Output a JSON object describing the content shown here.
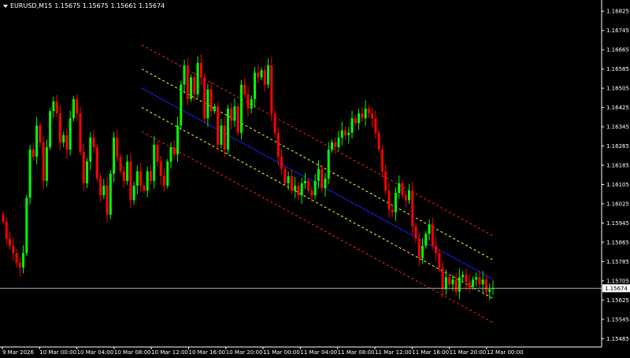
{
  "header": {
    "menu_icon": "triangle-down-icon",
    "symbol": "EURUSD,M15",
    "ohlc": "1.15675 1.15675 1.15661 1.15674"
  },
  "colors": {
    "background": "#000000",
    "bull": "#00ff00",
    "bear": "#ff0000",
    "channel_outer": "#ff2020",
    "channel_inner": "#ffff33",
    "regression": "#1e1eff",
    "bid_line": "#a0a0a0",
    "axis": "#ffffff"
  },
  "chart_data": {
    "type": "candlestick",
    "symbol": "EURUSD",
    "timeframe": "M15",
    "current_price": 1.15674,
    "y_range": [
      1.1543,
      1.1686
    ],
    "y_ticks": [
      "1.16825",
      "1.16745",
      "1.16665",
      "1.16585",
      "1.16505",
      "1.16425",
      "1.16345",
      "1.16265",
      "1.16185",
      "1.16105",
      "1.16025",
      "1.15945",
      "1.15865",
      "1.15785",
      "1.15705",
      "1.15625",
      "1.15545",
      "1.15465"
    ],
    "x_ticks": [
      "9 Mar 2026",
      "10 Mar 00:00",
      "10 Mar 04:00",
      "10 Mar 08:00",
      "10 Mar 12:00",
      "10 Mar 16:00",
      "10 Mar 20:00",
      "11 Mar 00:00",
      "11 Mar 04:00",
      "11 Mar 08:00",
      "11 Mar 12:00",
      "11 Mar 16:00",
      "11 Mar 20:00",
      "12 Mar 00:00"
    ],
    "candle_closes": [
      1.1595,
      1.1588,
      1.1585,
      1.1582,
      1.1578,
      1.1576,
      1.1582,
      1.1605,
      1.1625,
      1.1622,
      1.1635,
      1.1628,
      1.1612,
      1.1626,
      1.1641,
      1.1645,
      1.164,
      1.1628,
      1.1631,
      1.1625,
      1.1638,
      1.1646,
      1.164,
      1.1624,
      1.1611,
      1.162,
      1.163,
      1.1626,
      1.1613,
      1.1606,
      1.161,
      1.1598,
      1.1615,
      1.163,
      1.1622,
      1.1616,
      1.1612,
      1.162,
      1.1604,
      1.161,
      1.1616,
      1.161,
      1.1608,
      1.1616,
      1.1612,
      1.1627,
      1.162,
      1.1614,
      1.161,
      1.162,
      1.1626,
      1.1623,
      1.1635,
      1.1652,
      1.166,
      1.1646,
      1.1655,
      1.1648,
      1.1661,
      1.1655,
      1.1638,
      1.165,
      1.1641,
      1.1643,
      1.1627,
      1.1635,
      1.1625,
      1.1642,
      1.1637,
      1.1643,
      1.1632,
      1.1652,
      1.1648,
      1.1642,
      1.1646,
      1.1657,
      1.1655,
      1.1658,
      1.1652,
      1.166,
      1.164,
      1.1632,
      1.1622,
      1.1617,
      1.1611,
      1.1614,
      1.1608,
      1.161,
      1.1606,
      1.1611,
      1.1612,
      1.1608,
      1.1606,
      1.1612,
      1.1617,
      1.1609,
      1.1613,
      1.1625,
      1.1628,
      1.1626,
      1.163,
      1.1633,
      1.1631,
      1.1632,
      1.1638,
      1.1636,
      1.164,
      1.1638,
      1.1642,
      1.164,
      1.1638,
      1.1632,
      1.1625,
      1.1616,
      1.1608,
      1.16,
      1.1599,
      1.1607,
      1.1611,
      1.1606,
      1.1604,
      1.1608,
      1.1593,
      1.1588,
      1.158,
      1.1585,
      1.159,
      1.1594,
      1.1585,
      1.1582,
      1.1576,
      1.1567,
      1.1572,
      1.1569,
      1.1571,
      1.1566,
      1.1572,
      1.1573,
      1.157,
      1.1568,
      1.1571,
      1.1572,
      1.1569,
      1.1571,
      1.1566,
      1.1567,
      1.15674
    ]
  },
  "price_tag": "1.15674"
}
